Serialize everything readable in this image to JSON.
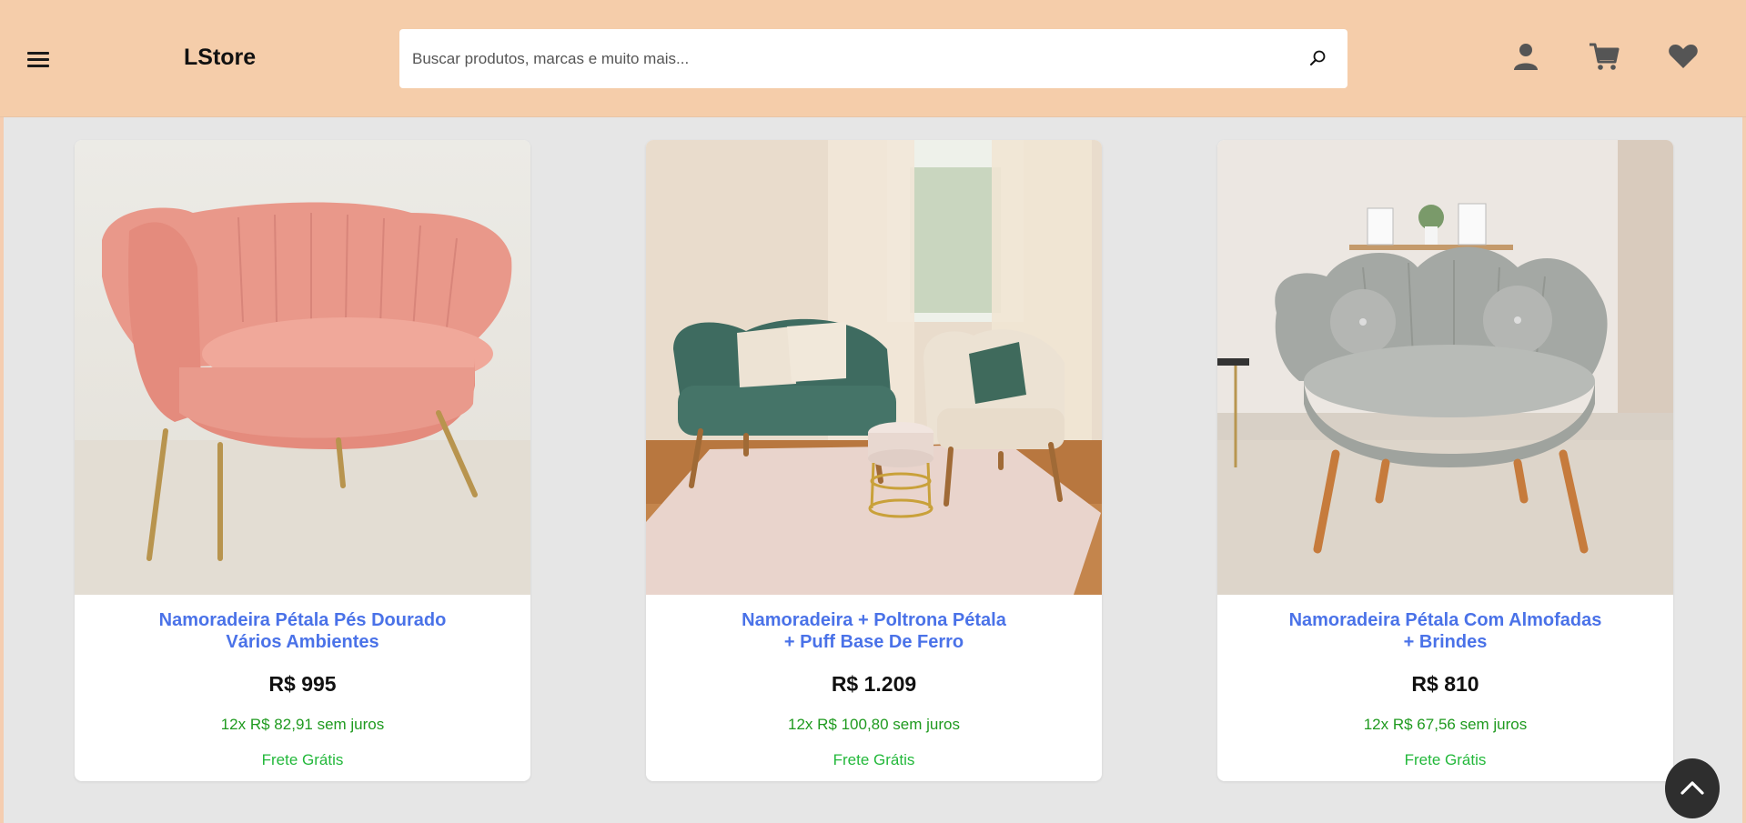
{
  "header": {
    "logo": "LStore",
    "search_placeholder": "Buscar produtos, marcas e muito mais...",
    "icons": [
      "menu-icon",
      "search-icon",
      "user-icon",
      "cart-icon",
      "heart-icon"
    ],
    "background": "#f5cdaa"
  },
  "products": [
    {
      "title_line1": "Namoradeira Pétala Pés Dourado",
      "title_line2": "Vários Ambientes",
      "price": "R$ 995",
      "installments": "12x R$ 82,91 sem juros",
      "shipping": "Frete Grátis",
      "image": "pink-loveseat-photo"
    },
    {
      "title_line1": "Namoradeira + Poltrona Pétala",
      "title_line2": "+ Puff Base De Ferro",
      "price": "R$ 1.209",
      "installments": "12x R$ 100,80 sem juros",
      "shipping": "Frete Grátis",
      "image": "green-loveseat-armchair-puff-photo"
    },
    {
      "title_line1": "Namoradeira Pétala Com Almofadas",
      "title_line2": "+ Brindes",
      "price": "R$ 810",
      "installments": "12x R$ 67,56 sem juros",
      "shipping": "Frete Grátis",
      "image": "gray-loveseat-pillows-photo"
    }
  ],
  "colors": {
    "title": "#4a72e8",
    "installments": "#1f9a1f",
    "shipping": "#22b83a",
    "page_bg": "#e6e6e6"
  },
  "scroll_top_icon": "chevron-up-icon"
}
